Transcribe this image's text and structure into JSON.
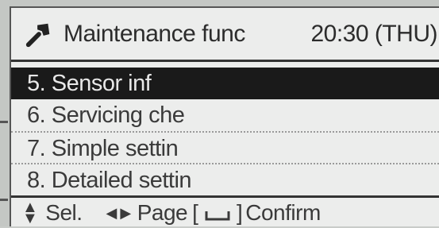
{
  "header": {
    "title": "Maintenance func",
    "time": "20:30 (THU)",
    "icon": "wrench-icon"
  },
  "menu": {
    "items": [
      {
        "label": "5. Sensor inf",
        "selected": true
      },
      {
        "label": "6. Servicing che",
        "selected": false
      },
      {
        "label": "7. Simple settin",
        "selected": false
      },
      {
        "label": "8. Detailed settin",
        "selected": false
      }
    ]
  },
  "footer": {
    "updown_icon": "updown-arrows-icon",
    "sel_label": "Sel.",
    "leftright_icon": "left-right-arrows-icon",
    "page_label": "Page",
    "enter_open": "[",
    "enter_close": "]",
    "confirm_label": "Confirm"
  }
}
